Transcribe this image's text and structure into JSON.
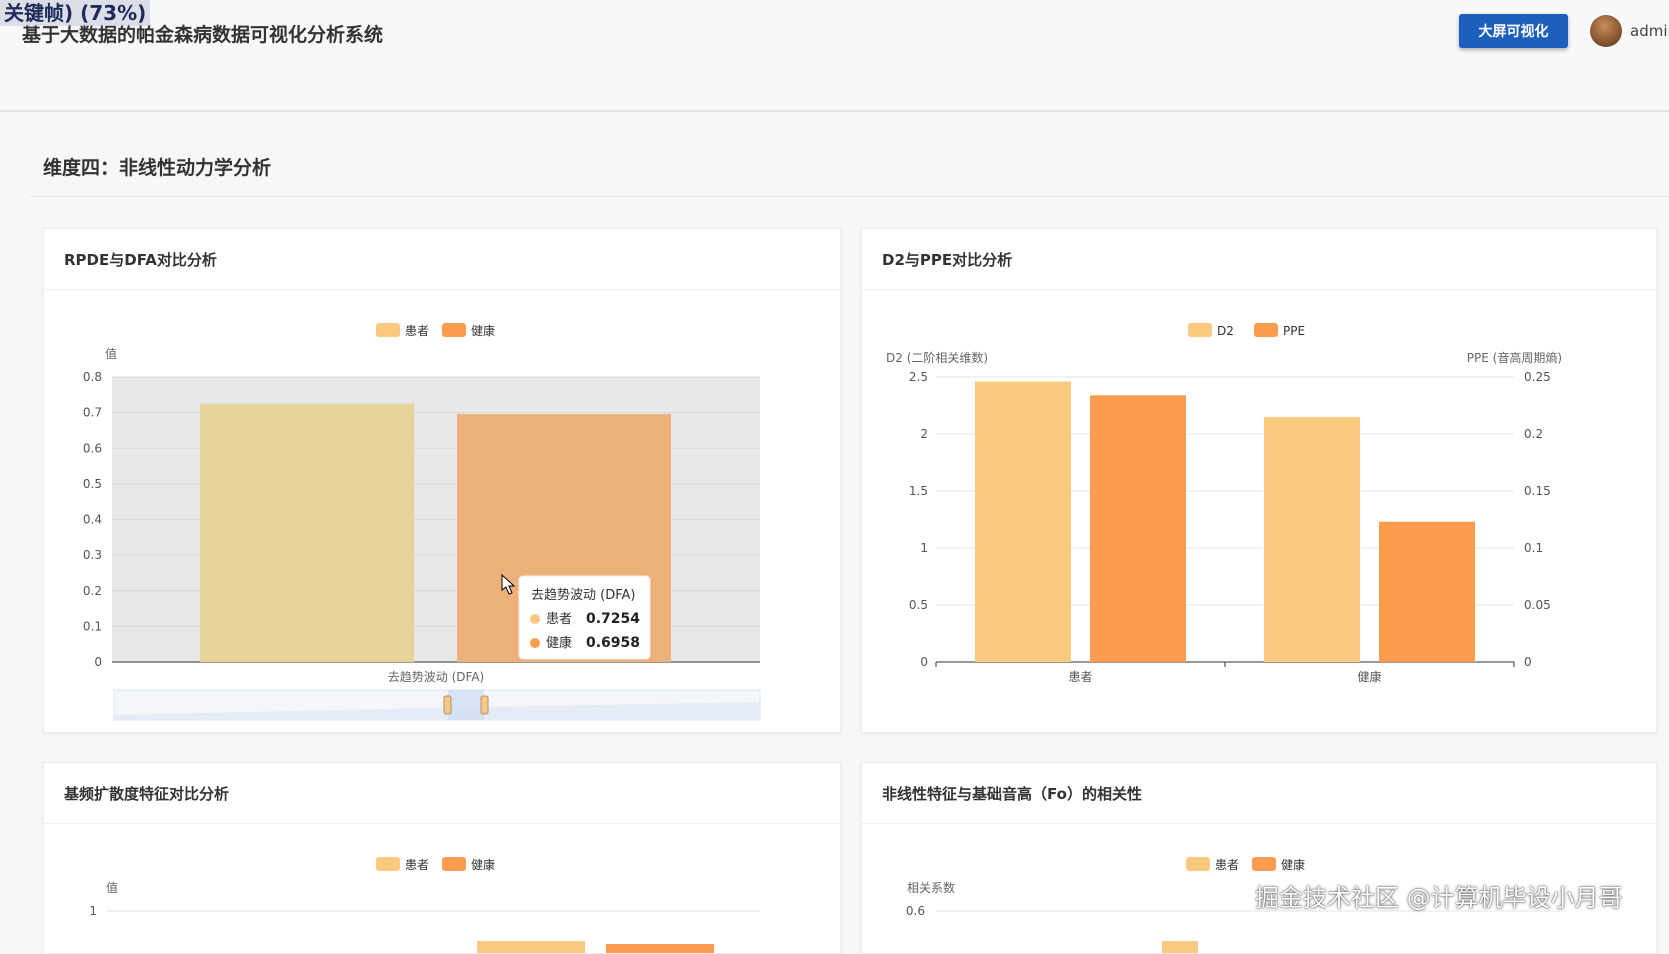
{
  "header": {
    "overlay_label": "关键帧) (73%)",
    "title": "基于大数据的帕金森病数据可视化分析系统",
    "bigscreen_button": "大屏可视化",
    "username": "admin"
  },
  "section": {
    "title": "维度四：非线性动力学分析"
  },
  "cards": [
    {
      "title": "RPDE与DFA对比分析"
    },
    {
      "title": "D2与PPE对比分析"
    },
    {
      "title": "基频扩散度特征对比分析"
    },
    {
      "title": "非线性特征与基础音高（Fo）的相关性"
    }
  ],
  "colors": {
    "patient": "#f9c97f",
    "healthy": "#fb9c4e",
    "patient_dim": "#e8d39a",
    "healthy_dim": "#ecb07a",
    "accent": "#1c5fbd"
  },
  "watermark": "掘金技术社区 @计算机毕设小月哥",
  "chart_data": [
    {
      "type": "bar",
      "ylabel": "值",
      "ylim": [
        0,
        0.8
      ],
      "yticks": [
        "0",
        "0.1",
        "0.2",
        "0.3",
        "0.4",
        "0.5",
        "0.6",
        "0.7",
        "0.8"
      ],
      "categories": [
        "去趋势波动 (DFA)"
      ],
      "series": [
        {
          "name": "患者",
          "values": [
            0.7254
          ]
        },
        {
          "name": "健康",
          "values": [
            0.6958
          ]
        }
      ],
      "legend": "top-center",
      "grid": true,
      "tooltip": {
        "title": "去趋势波动 (DFA)",
        "rows": [
          {
            "name": "患者",
            "value": "0.7254"
          },
          {
            "name": "健康",
            "value": "0.6958"
          }
        ]
      }
    },
    {
      "type": "bar",
      "ylabel_left": "D2 (二阶相关维数)",
      "ylabel_right": "PPE (音高周期熵)",
      "ylim_left": [
        0,
        2.5
      ],
      "ylim_right": [
        0,
        0.25
      ],
      "yticks_left": [
        "0",
        "0.5",
        "1",
        "1.5",
        "2",
        "2.5"
      ],
      "yticks_right": [
        "0",
        "0.05",
        "0.1",
        "0.15",
        "0.2",
        "0.25"
      ],
      "categories": [
        "患者",
        "健康"
      ],
      "series": [
        {
          "name": "D2",
          "axis": "left",
          "values": [
            2.46,
            2.15
          ]
        },
        {
          "name": "PPE",
          "axis": "right",
          "values": [
            0.234,
            0.123
          ]
        }
      ],
      "legend": "top-center",
      "grid": true
    },
    {
      "type": "bar",
      "ylabel": "值",
      "yticks": [
        "1"
      ],
      "series": [
        {
          "name": "患者"
        },
        {
          "name": "健康"
        }
      ],
      "legend": "top-center"
    },
    {
      "type": "bar",
      "ylabel": "相关系数",
      "yticks": [
        "0.6"
      ],
      "series": [
        {
          "name": "患者"
        },
        {
          "name": "健康"
        }
      ],
      "legend": "top-center"
    }
  ]
}
